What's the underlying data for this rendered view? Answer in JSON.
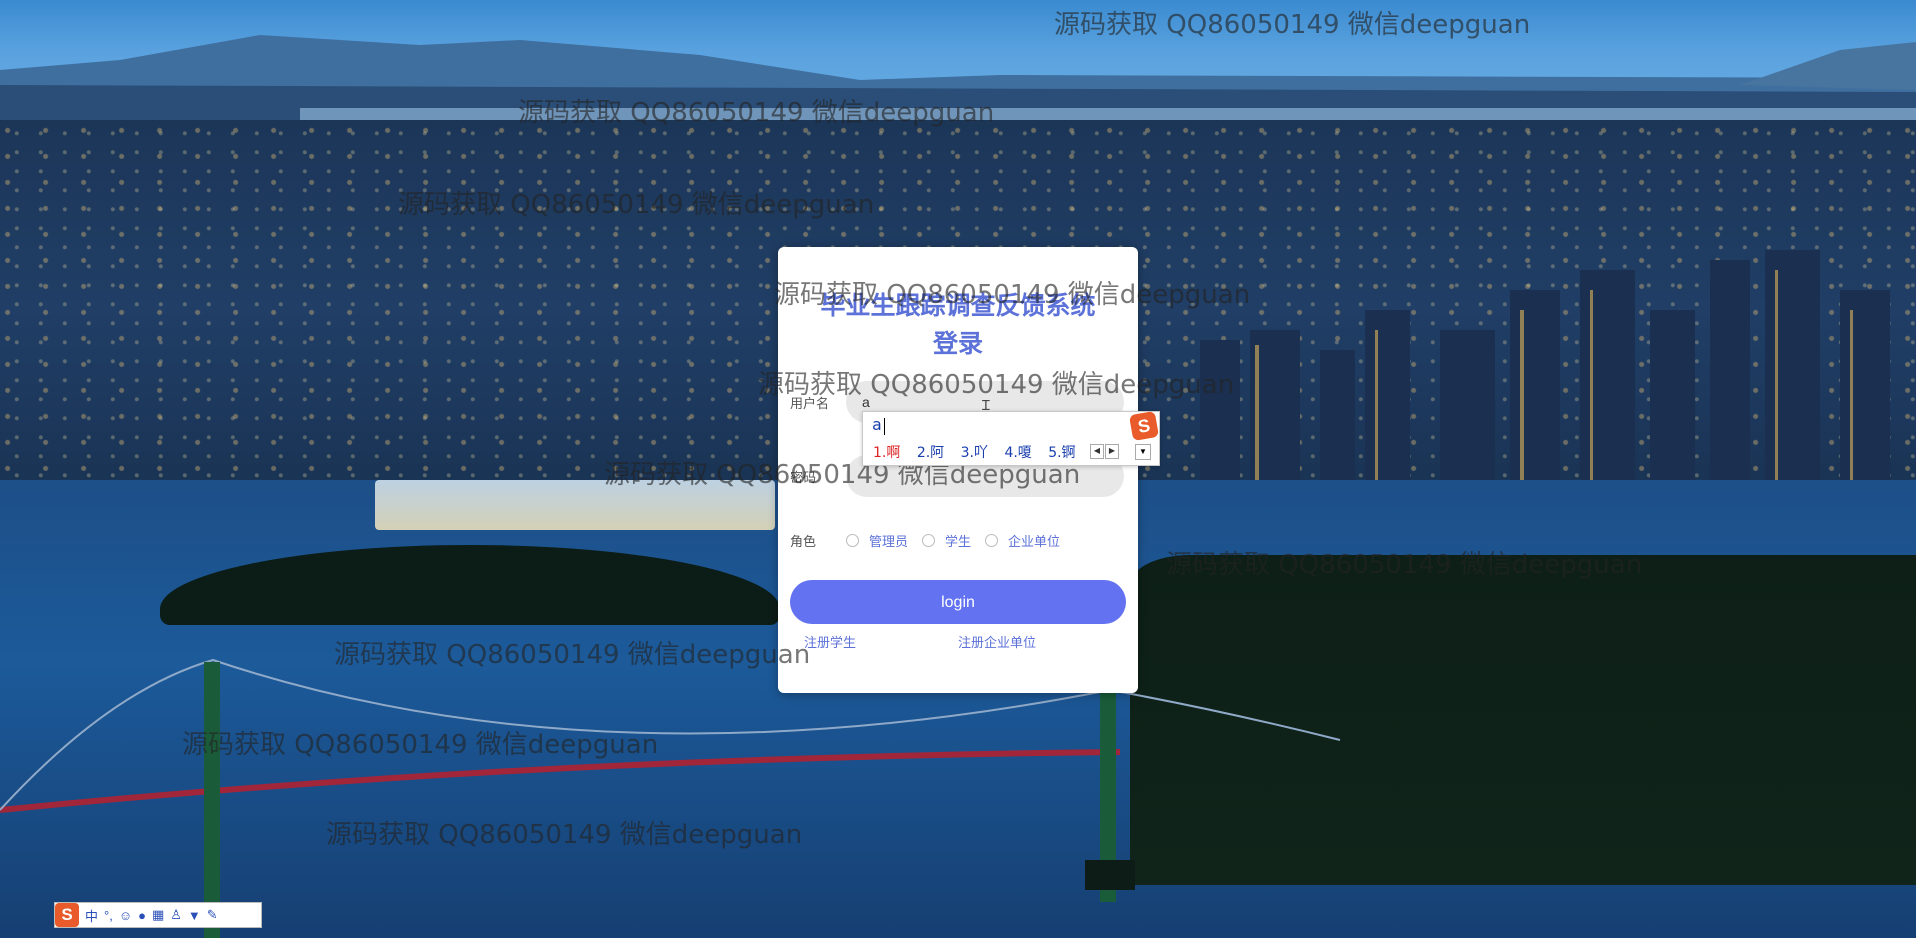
{
  "watermark_text": "源码获取 QQ86050149 微信deepguan",
  "login": {
    "title_line1": "毕业生跟踪调查反馈系统",
    "title_line2": "登录",
    "username_label": "用户名",
    "username_value": "a",
    "password_label": "密码",
    "password_value": "",
    "role_label": "角色",
    "roles": [
      "管理员",
      "学生",
      "企业单位"
    ],
    "login_button": "login",
    "register_student": "注册学生",
    "register_company": "注册企业单位"
  },
  "ime_popup": {
    "composition": "a",
    "candidates": [
      "1.啊",
      "2.阿",
      "3.吖",
      "4.嗄",
      "5.锕"
    ],
    "logo": "S"
  },
  "ime_bar": {
    "logo": "S",
    "mode": "中"
  },
  "colors": {
    "accent": "#5c72d8",
    "button": "#6272f0",
    "ime_logo": "#e95b2a"
  }
}
